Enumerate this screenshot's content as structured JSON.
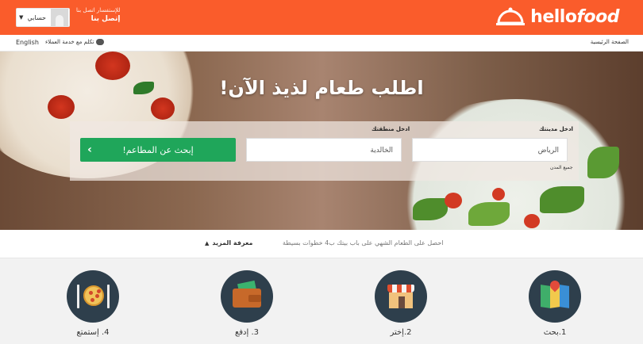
{
  "header": {
    "brand": "hellofood",
    "brand_part1": "hello",
    "brand_part2": "food",
    "contact_small": "للإستفسار اتصل بنا",
    "contact_big": "إتصل بنا",
    "account_label": "حسابي",
    "brand_color": "#fa5c2b"
  },
  "subbar": {
    "home": "الصفحة الرئيسية",
    "language": "English",
    "support": "تكلم مع خدمة العملاء"
  },
  "hero": {
    "title": "اطلب طعام لذيذ الآن!",
    "city_label": "ادخل مدينتك",
    "city_value": "الرياض",
    "area_label": "ادخل منطقتك",
    "area_value": "الخالدية",
    "all_cities": "جميع المدن",
    "search_button": "إبحث عن المطاعم!",
    "button_color": "#1fa65a"
  },
  "info": {
    "description": "احصل على الطعام الشهي على باب بيتك ب4 خطوات بسيطة",
    "learn_more": "معرفة المزيد"
  },
  "steps": [
    {
      "label": "1.بحث",
      "icon": "map-icon"
    },
    {
      "label": "2.إختر",
      "icon": "store-icon"
    },
    {
      "label": "3. إدفع",
      "icon": "wallet-icon"
    },
    {
      "label": "4. إستمتع",
      "icon": "pizza-plate-icon"
    }
  ]
}
